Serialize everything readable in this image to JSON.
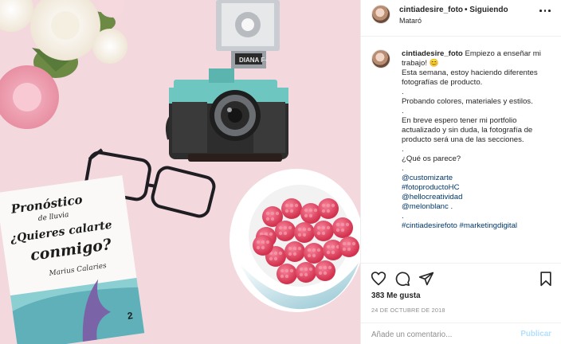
{
  "post": {
    "username": "cintiadesire_foto",
    "separator": "•",
    "follow_status": "Siguiendo",
    "location": "Mataró"
  },
  "caption": {
    "username": "cintiadesire_foto",
    "line1": "Empiezo a enseñar mi trabajo!",
    "emoji": "😊",
    "lines": [
      "Esta semana, estoy haciendo diferentes fotografías de producto.",
      ".",
      "Probando colores, materiales y estilos.",
      ".",
      "En breve espero tener mi portfolio actualizado y sin duda, la fotografía de producto será una de las secciones.",
      ".",
      "¿Qué os parece?",
      "."
    ],
    "tags": [
      "@customizarte",
      "#fotoproductoHC",
      "@hellocreatividad",
      "@melonblanc ."
    ],
    "tags2": [
      ".",
      "#cintiadesirefoto #marketingdigital"
    ]
  },
  "stats": {
    "likes": "383 Me gusta",
    "date": "24 DE OCTUBRE DE 2018"
  },
  "comment": {
    "placeholder": "Añade un comentario...",
    "publish_label": "Publicar"
  },
  "photo": {
    "book_line1": "Pronóstico",
    "book_line2": "de lluvia",
    "book_line3": "¿Quieres calarte",
    "book_line4": "conmigo?",
    "book_author": "Marius Calaries",
    "book_number": "2",
    "camera_label": "DIANA F+"
  },
  "colors": {
    "background": "#f3d8de",
    "camera_teal": "#6ec6c0",
    "raspberry": "#e0485e",
    "link": "#00376b",
    "publish_disabled": "#b2dffc"
  }
}
